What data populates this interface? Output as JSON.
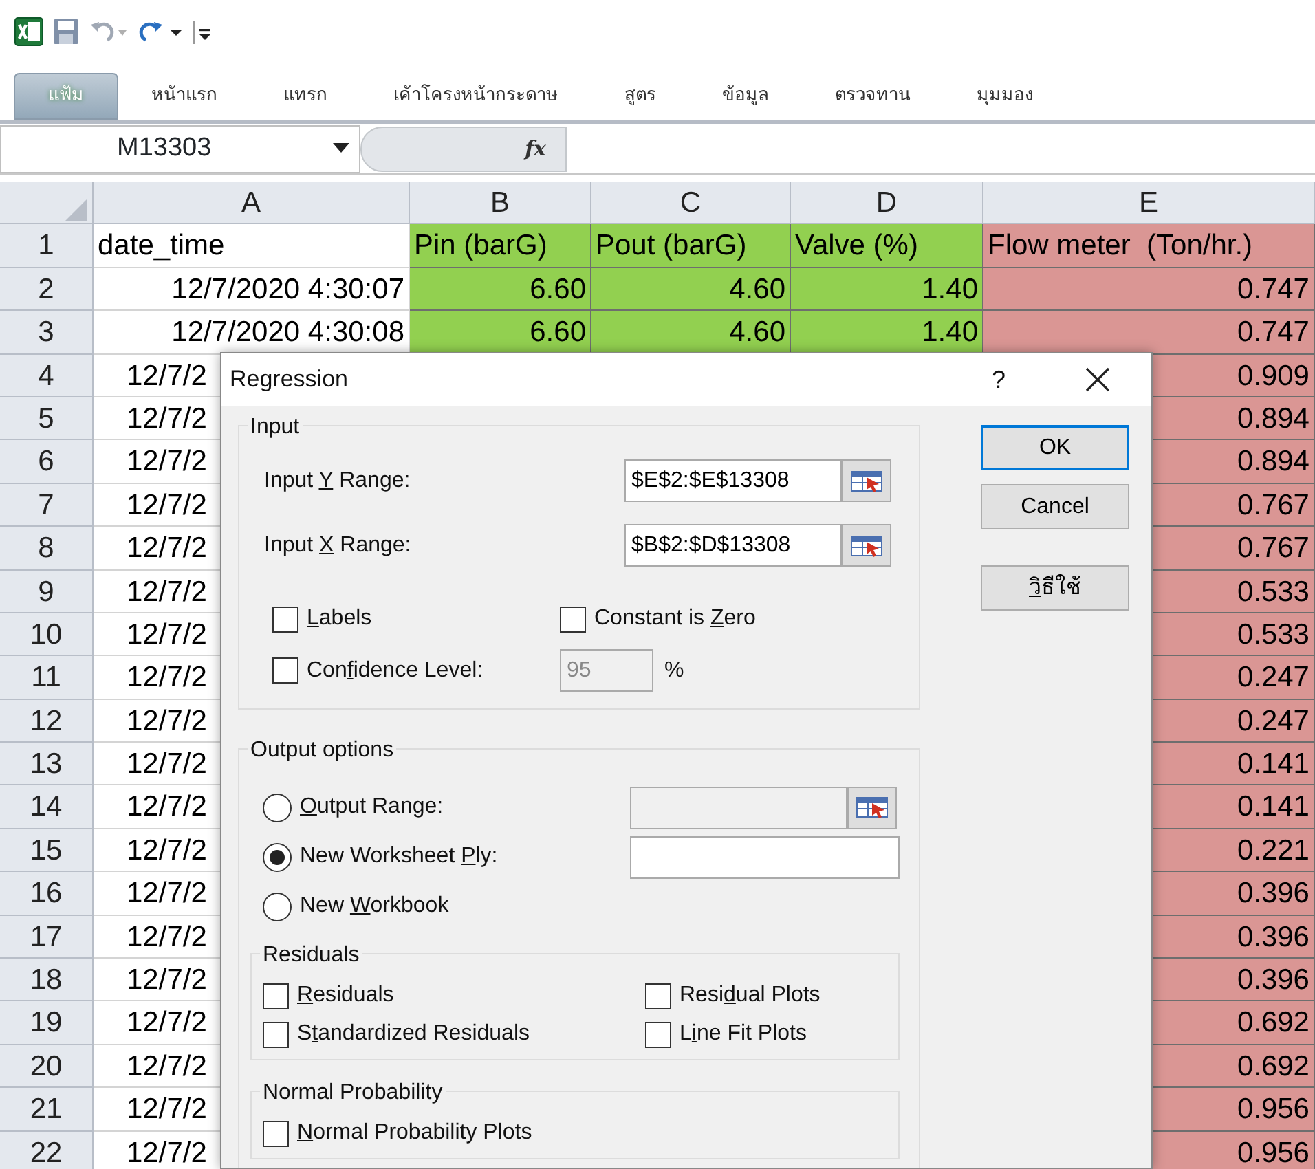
{
  "ribbon_tabs": [
    {
      "label": "แฟ้ม",
      "kind": "file"
    },
    {
      "label": "หน้าแรก",
      "kind": "tab"
    },
    {
      "label": "แทรก",
      "kind": "tab"
    },
    {
      "label": "เค้าโครงหน้ากระดาษ",
      "kind": "tab"
    },
    {
      "label": "สูตร",
      "kind": "tab"
    },
    {
      "label": "ข้อมูล",
      "kind": "tab"
    },
    {
      "label": "ตรวจทาน",
      "kind": "tab"
    },
    {
      "label": "มุมมอง",
      "kind": "tab"
    }
  ],
  "formula_bar": {
    "name_box": "M13303",
    "function_label": "fx"
  },
  "sheet": {
    "columns": [
      {
        "label": "A"
      },
      {
        "label": "B",
        "color": "#92d050"
      },
      {
        "label": "C",
        "color": "#92d050"
      },
      {
        "label": "D",
        "color": "#92d050"
      },
      {
        "label": "E",
        "color": "#da9694"
      }
    ],
    "rows": [
      {
        "number": "1",
        "kind": "header",
        "cells": [
          "date_time",
          "Pin (barG)",
          "Pout (barG)",
          "Valve (%)",
          "Flow meter  (Ton/hr.)"
        ]
      },
      {
        "number": "2",
        "kind": "data",
        "cells": [
          "12/7/2020 4:30:07",
          "6.60",
          "4.60",
          "1.40",
          "0.747"
        ]
      },
      {
        "number": "3",
        "kind": "data",
        "cells": [
          "12/7/2020 4:30:08",
          "6.60",
          "4.60",
          "1.40",
          "0.747"
        ]
      },
      {
        "number": "4",
        "kind": "cut",
        "cells": [
          "12/7/2",
          null,
          null,
          null,
          "0.909"
        ]
      },
      {
        "number": "5",
        "kind": "cut",
        "cells": [
          "12/7/2",
          null,
          null,
          null,
          "0.894"
        ]
      },
      {
        "number": "6",
        "kind": "cut",
        "cells": [
          "12/7/2",
          null,
          null,
          null,
          "0.894"
        ]
      },
      {
        "number": "7",
        "kind": "cut",
        "cells": [
          "12/7/2",
          null,
          null,
          null,
          "0.767"
        ]
      },
      {
        "number": "8",
        "kind": "cut",
        "cells": [
          "12/7/2",
          null,
          null,
          null,
          "0.767"
        ]
      },
      {
        "number": "9",
        "kind": "cut",
        "cells": [
          "12/7/2",
          null,
          null,
          null,
          "0.533"
        ]
      },
      {
        "number": "10",
        "kind": "cut",
        "cells": [
          "12/7/2",
          null,
          null,
          null,
          "0.533"
        ]
      },
      {
        "number": "11",
        "kind": "cut",
        "cells": [
          "12/7/2",
          null,
          null,
          null,
          "0.247"
        ]
      },
      {
        "number": "12",
        "kind": "cut",
        "cells": [
          "12/7/2",
          null,
          null,
          null,
          "0.247"
        ]
      },
      {
        "number": "13",
        "kind": "cut",
        "cells": [
          "12/7/2",
          null,
          null,
          null,
          "0.141"
        ]
      },
      {
        "number": "14",
        "kind": "cut",
        "cells": [
          "12/7/2",
          null,
          null,
          null,
          "0.141"
        ]
      },
      {
        "number": "15",
        "kind": "cut",
        "cells": [
          "12/7/2",
          null,
          null,
          null,
          "0.221"
        ]
      },
      {
        "number": "16",
        "kind": "cut",
        "cells": [
          "12/7/2",
          null,
          null,
          null,
          "0.396"
        ]
      },
      {
        "number": "17",
        "kind": "cut",
        "cells": [
          "12/7/2",
          null,
          null,
          null,
          "0.396"
        ]
      },
      {
        "number": "18",
        "kind": "cut",
        "cells": [
          "12/7/2",
          null,
          null,
          null,
          "0.396"
        ]
      },
      {
        "number": "19",
        "kind": "cut",
        "cells": [
          "12/7/2",
          null,
          null,
          null,
          "0.692"
        ]
      },
      {
        "number": "20",
        "kind": "cut",
        "cells": [
          "12/7/2",
          null,
          null,
          null,
          "0.692"
        ]
      },
      {
        "number": "21",
        "kind": "cut",
        "cells": [
          "12/7/2",
          null,
          null,
          null,
          "0.956"
        ]
      },
      {
        "number": "22",
        "kind": "cut",
        "cells": [
          "12/7/2",
          null,
          null,
          null,
          "0.956"
        ]
      }
    ]
  },
  "dialog": {
    "title": "Regression",
    "help_mark": "?",
    "input": {
      "legend": "Input",
      "fields": [
        {
          "label": [
            {
              "text": "Input "
            },
            {
              "text": "Y",
              "underline": true
            },
            {
              "text": " Range:"
            }
          ],
          "value": "$E$2:$E$13308"
        },
        {
          "label": [
            {
              "text": "Input "
            },
            {
              "text": "X",
              "underline": true
            },
            {
              "text": " Range:"
            }
          ],
          "value": "$B$2:$D$13308"
        }
      ],
      "labels": {
        "checked": false,
        "label": [
          {
            "text": "L",
            "underline": true
          },
          {
            "text": "abels"
          }
        ]
      },
      "constant_zero": {
        "checked": false,
        "label": [
          {
            "text": "Constant is "
          },
          {
            "text": "Z",
            "underline": true
          },
          {
            "text": "ero"
          }
        ]
      },
      "confidence": {
        "checked": false,
        "label": [
          {
            "text": "Con"
          },
          {
            "text": "f",
            "underline": true
          },
          {
            "text": "idence Level:"
          }
        ],
        "value": "95",
        "disabled": true,
        "unit": "%"
      }
    },
    "output": {
      "legend": "Output options",
      "choices": [
        {
          "label": [
            {
              "text": "O",
              "underline": true
            },
            {
              "text": "utput Range:"
            }
          ],
          "selected": false,
          "kind": "picker",
          "disabled": true
        },
        {
          "label": [
            {
              "text": "New Worksheet "
            },
            {
              "text": "P",
              "underline": true
            },
            {
              "text": "ly:"
            }
          ],
          "selected": true,
          "kind": "plain",
          "disabled": false
        },
        {
          "label": [
            {
              "text": "New "
            },
            {
              "text": "W",
              "underline": true
            },
            {
              "text": "orkbook"
            }
          ],
          "selected": false,
          "kind": "bare"
        }
      ],
      "residuals": {
        "legend": "Residuals",
        "options": [
          {
            "label": [
              {
                "text": "R",
                "underline": true
              },
              {
                "text": "esiduals"
              }
            ],
            "checked": false
          },
          {
            "label": [
              {
                "text": "Resi"
              },
              {
                "text": "d",
                "underline": true
              },
              {
                "text": "ual Plots"
              }
            ],
            "checked": false
          },
          {
            "label": [
              {
                "text": "S"
              },
              {
                "text": "t",
                "underline": true
              },
              {
                "text": "andardized Residuals"
              }
            ],
            "checked": false
          },
          {
            "label": [
              {
                "text": "L"
              },
              {
                "text": "i",
                "underline": true
              },
              {
                "text": "ne Fit Plots"
              }
            ],
            "checked": false
          }
        ]
      },
      "normal": {
        "legend": "Normal Probability",
        "options": [
          {
            "label": [
              {
                "text": "N",
                "underline": true
              },
              {
                "text": "ormal Probability Plots"
              }
            ],
            "checked": false
          }
        ]
      }
    },
    "buttons": [
      {
        "label": [
          {
            "text": "OK"
          }
        ],
        "default": true
      },
      {
        "label": [
          {
            "text": "Cancel"
          }
        ],
        "default": false
      },
      {
        "label": [
          {
            "text": "วิ",
            "underline": true
          },
          {
            "text": "ธีใช้"
          }
        ],
        "default": false
      }
    ]
  }
}
